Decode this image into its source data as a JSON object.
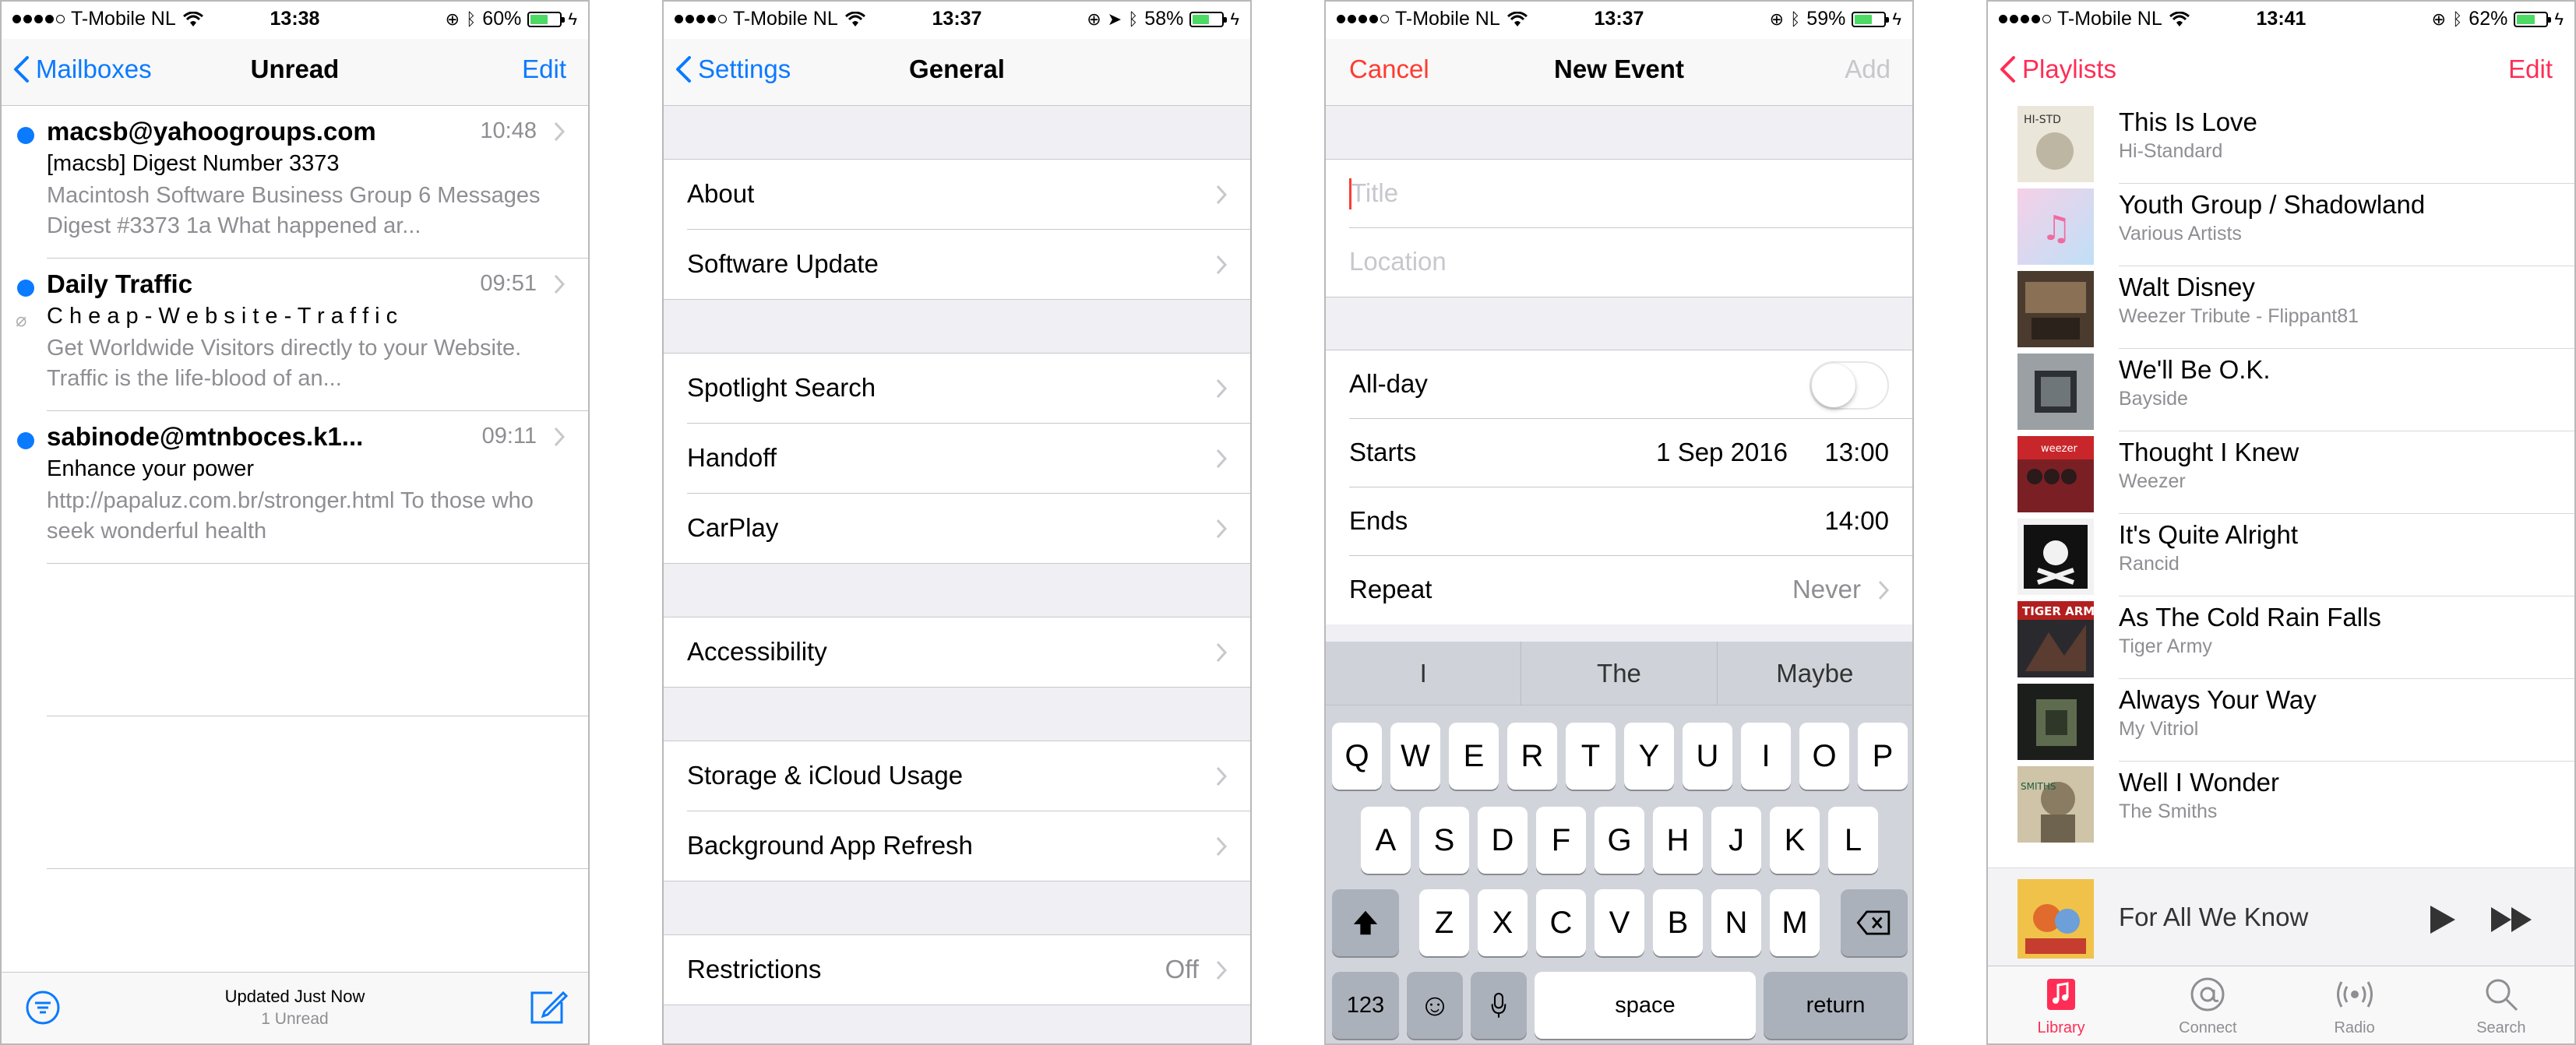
{
  "screens": {
    "mail": {
      "status": {
        "carrier": "T-Mobile NL",
        "time": "13:38",
        "battery": "60%"
      },
      "nav": {
        "back_label": "Mailboxes",
        "title": "Unread",
        "right_label": "Edit"
      },
      "messages": [
        {
          "sender": "macsb@yahoogroups.com",
          "time": "10:48",
          "subject": "[macsb] Digest Number 3373",
          "preview": "Macintosh Software Business Group 6 Messages Digest #3373 1a What happened ar..."
        },
        {
          "sender": "Daily Traffic",
          "time": "09:51",
          "subject": "C h e a p - W e b s i t e - T r a f f i c",
          "preview": "Get Worldwide Visitors directly to your Website. Traffic is the life-blood of an..."
        },
        {
          "sender": "sabinode@mtnboces.k1...",
          "time": "09:11",
          "subject": "Enhance your power",
          "preview": "http://papaluz.com.br/stronger.html To those who seek wonderful health"
        }
      ],
      "toolbar": {
        "status_main": "Updated Just Now",
        "status_sub": "1 Unread"
      }
    },
    "settings": {
      "status": {
        "carrier": "T-Mobile NL",
        "time": "13:37",
        "battery": "58%"
      },
      "nav": {
        "back_label": "Settings",
        "title": "General"
      },
      "groups": [
        [
          {
            "label": "About"
          },
          {
            "label": "Software Update"
          }
        ],
        [
          {
            "label": "Spotlight Search"
          },
          {
            "label": "Handoff"
          },
          {
            "label": "CarPlay"
          }
        ],
        [
          {
            "label": "Accessibility"
          }
        ],
        [
          {
            "label": "Storage & iCloud Usage"
          },
          {
            "label": "Background App Refresh"
          }
        ],
        [
          {
            "label": "Restrictions",
            "value": "Off"
          }
        ]
      ]
    },
    "calendar": {
      "status": {
        "carrier": "T-Mobile NL",
        "time": "13:37",
        "battery": "59%"
      },
      "nav": {
        "left_label": "Cancel",
        "title": "New Event",
        "right_label": "Add"
      },
      "title_placeholder": "Title",
      "location_placeholder": "Location",
      "allday_label": "All-day",
      "starts_label": "Starts",
      "starts_date": "1 Sep 2016",
      "starts_time": "13:00",
      "ends_label": "Ends",
      "ends_time": "14:00",
      "repeat_label": "Repeat",
      "repeat_value": "Never",
      "predictions": [
        "I",
        "The",
        "Maybe"
      ],
      "keyboard": {
        "row1": [
          "Q",
          "W",
          "E",
          "R",
          "T",
          "Y",
          "U",
          "I",
          "O",
          "P"
        ],
        "row2": [
          "A",
          "S",
          "D",
          "F",
          "G",
          "H",
          "J",
          "K",
          "L"
        ],
        "row3": [
          "Z",
          "X",
          "C",
          "V",
          "B",
          "N",
          "M"
        ],
        "numbers_label": "123",
        "space_label": "space",
        "return_label": "return"
      }
    },
    "music": {
      "status": {
        "carrier": "T-Mobile NL",
        "time": "13:41",
        "battery": "62%"
      },
      "nav": {
        "back_label": "Playlists",
        "right_label": "Edit"
      },
      "songs": [
        {
          "title": "This Is Love",
          "artist": "Hi-Standard"
        },
        {
          "title": "Youth Group / Shadowland",
          "artist": "Various Artists"
        },
        {
          "title": "Walt Disney",
          "artist": "Weezer Tribute - Flippant81"
        },
        {
          "title": "We'll Be O.K.",
          "artist": "Bayside"
        },
        {
          "title": "Thought I Knew",
          "artist": "Weezer"
        },
        {
          "title": "It's Quite Alright",
          "artist": "Rancid"
        },
        {
          "title": "As The Cold Rain Falls",
          "artist": "Tiger Army"
        },
        {
          "title": "Always Your Way",
          "artist": "My Vitriol"
        },
        {
          "title": "Well I Wonder",
          "artist": "The Smiths"
        }
      ],
      "now_playing": "For All We Know",
      "tabs": [
        "Library",
        "Connect",
        "Radio",
        "Search"
      ]
    }
  },
  "colors": {
    "ios_blue": "#0a7aff",
    "music_pink": "#ff2d55",
    "cancel_red": "#ff3b30",
    "battery_green": "#4cd964",
    "unread_dot": "#0a7aff"
  }
}
